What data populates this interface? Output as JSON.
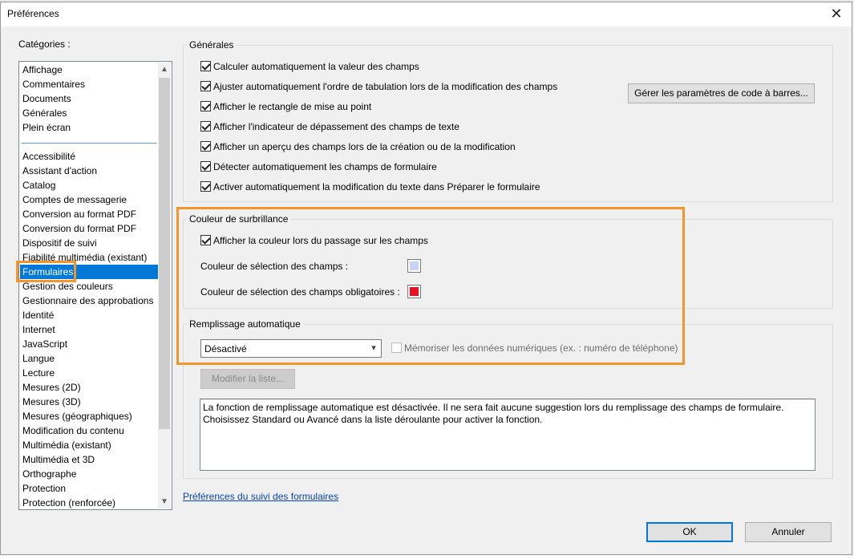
{
  "window": {
    "title": "Préférences",
    "close_glyph": "✕"
  },
  "categories": {
    "label": "Catégories :",
    "top_items": [
      "Affichage",
      "Commentaires",
      "Documents",
      "Générales",
      "Plein écran"
    ],
    "items": [
      "Accessibilité",
      "Assistant d'action",
      "Catalog",
      "Comptes de messagerie",
      "Conversion au format PDF",
      "Conversion du format PDF",
      "Dispositif de suivi",
      "Fiabilité multimédia (existant)",
      "Formulaires",
      "Gestion des couleurs",
      "Gestionnaire des approbations",
      "Identité",
      "Internet",
      "JavaScript",
      "Langue",
      "Lecture",
      "Mesures (2D)",
      "Mesures (3D)",
      "Mesures (géographiques)",
      "Modification du contenu",
      "Multimédia (existant)",
      "Multimédia et 3D",
      "Orthographe",
      "Protection",
      "Protection (renforcée)"
    ],
    "selected": "Formulaires",
    "scroll_up_icon": "chevron-up-icon",
    "scroll_down_icon": "chevron-down-icon"
  },
  "general": {
    "title": "Générales",
    "options": [
      {
        "label": "Calculer automatiquement la valeur des champs",
        "checked": true
      },
      {
        "label": "Ajuster automatiquement l'ordre de tabulation lors de la modification des champs",
        "checked": true
      },
      {
        "label": "Afficher le rectangle de mise au point",
        "checked": true
      },
      {
        "label": "Afficher l'indicateur de dépassement des champs de texte",
        "checked": true
      },
      {
        "label": "Afficher un aperçu des champs lors de la création ou de la modification",
        "checked": true
      },
      {
        "label": "Détecter automatiquement les champs de formulaire",
        "checked": true
      },
      {
        "label": "Activer automatiquement la modification du texte dans Préparer le formulaire",
        "checked": true
      }
    ],
    "barcode_button": "Gérer les paramètres de code à barres..."
  },
  "highlight": {
    "title": "Couleur de surbrillance",
    "show_on_hover_label": "Afficher la couleur lors du passage sur les champs",
    "show_on_hover_checked": true,
    "field_color_label": "Couleur de sélection des champs :",
    "field_color": "#c6d3f7",
    "required_color_label": "Couleur de sélection des champs obligatoires :",
    "required_color": "#e81123"
  },
  "autofill": {
    "title": "Remplissage automatique",
    "mode": "Désactivé",
    "remember_numeric_label": "Mémoriser les données numériques (ex. : numéro de téléphone)",
    "remember_numeric_checked": false,
    "edit_list_button": "Modifier la liste...",
    "info_text_line1": "La fonction de remplissage automatique est désactivée. Il ne sera fait aucune suggestion lors du remplissage des champs de formulaire.",
    "info_text_line2": "Choisissez Standard ou Avancé dans la liste déroulante pour activer la fonction."
  },
  "tracker_link": "Préférences du suivi des formulaires",
  "buttons": {
    "ok": "OK",
    "cancel": "Annuler"
  },
  "colors": {
    "accent": "#0078d7",
    "annotation": "#f0962d"
  }
}
